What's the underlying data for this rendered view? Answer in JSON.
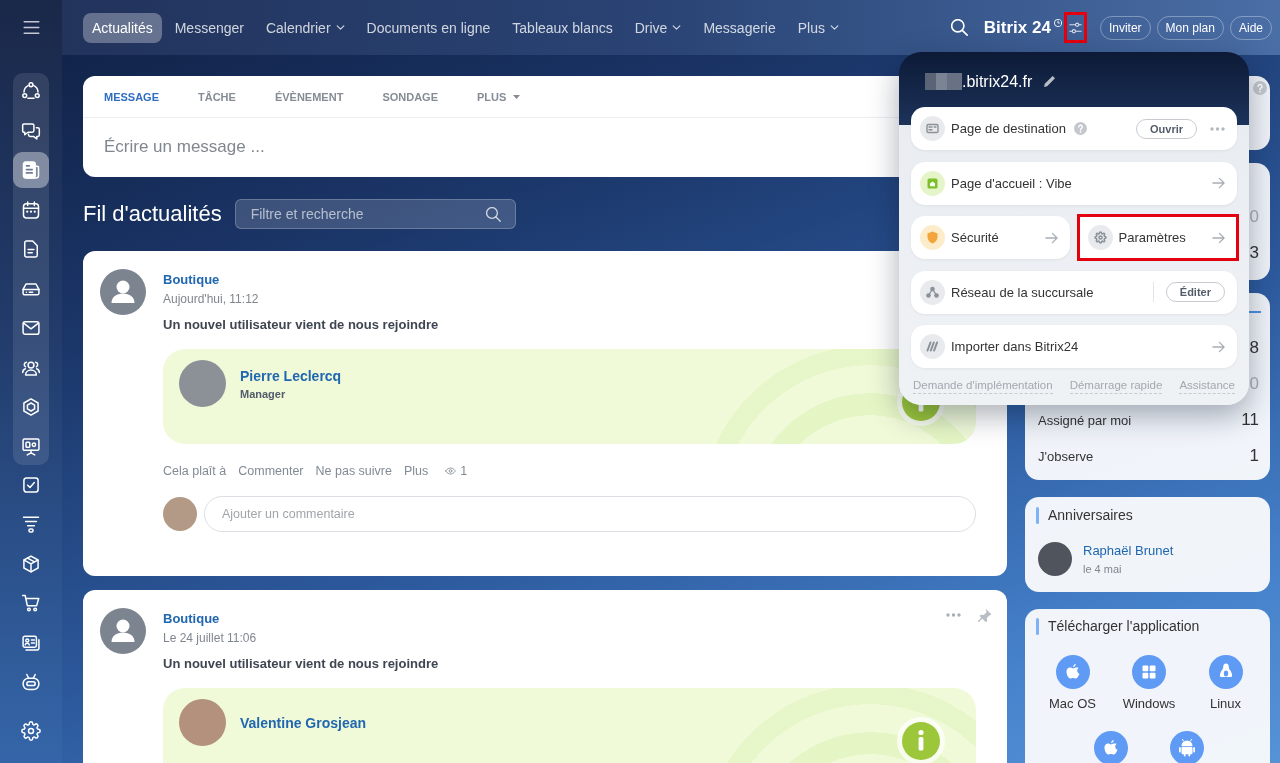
{
  "sidebar": {
    "pinned": [
      {
        "kind": "flows",
        "selected": false
      },
      {
        "kind": "chat",
        "selected": false
      },
      {
        "kind": "news",
        "selected": true
      },
      {
        "kind": "calendar",
        "selected": false
      },
      {
        "kind": "docs",
        "selected": false
      },
      {
        "kind": "drive",
        "selected": false
      },
      {
        "kind": "mail",
        "selected": false
      },
      {
        "kind": "groups",
        "selected": false
      },
      {
        "kind": "hexagon",
        "selected": false
      },
      {
        "kind": "board",
        "selected": false
      }
    ],
    "items": [
      {
        "kind": "tasks",
        "selected": false
      },
      {
        "kind": "funnel",
        "selected": false
      },
      {
        "kind": "box",
        "selected": false
      },
      {
        "kind": "cart",
        "selected": false
      },
      {
        "kind": "card",
        "selected": false
      },
      {
        "kind": "robot",
        "selected": false
      }
    ],
    "bottom": [
      {
        "kind": "settings",
        "selected": false
      }
    ]
  },
  "topbar": {
    "menu": [
      {
        "label": "Actualités",
        "selected": true,
        "dropdown": false
      },
      {
        "label": "Messenger",
        "selected": false,
        "dropdown": false
      },
      {
        "label": "Calendrier",
        "selected": false,
        "dropdown": true
      },
      {
        "label": "Documents en ligne",
        "selected": false,
        "dropdown": false
      },
      {
        "label": "Tableaux blancs",
        "selected": false,
        "dropdown": false
      },
      {
        "label": "Drive",
        "selected": false,
        "dropdown": true
      },
      {
        "label": "Messagerie",
        "selected": false,
        "dropdown": false
      },
      {
        "label": "Plus",
        "selected": false,
        "dropdown": true
      }
    ],
    "brand": "Bitrix 24",
    "settings": {
      "highlighted": true
    },
    "buttons": [
      "Inviter",
      "Mon plan",
      "Aide"
    ]
  },
  "composer": {
    "tabs": [
      {
        "label": "MESSAGE",
        "selected": true,
        "dropdown": false
      },
      {
        "label": "TÂCHE",
        "selected": false,
        "dropdown": false
      },
      {
        "label": "ÉVÈNEMENT",
        "selected": false,
        "dropdown": false
      },
      {
        "label": "SONDAGE",
        "selected": false,
        "dropdown": false
      },
      {
        "label": "PLUS",
        "selected": false,
        "dropdown": true
      }
    ],
    "placeholder": "Écrire un message ..."
  },
  "feed": {
    "title": "Fil d'actualités",
    "search": {
      "placeholder": "Filtre et recherche"
    },
    "posts": [
      {
        "author": "Boutique",
        "time": "Aujourd'hui, 11:12",
        "text": "Un nouvel utilisateur vient de nous rejoindre",
        "user": {
          "name": "Pierre Leclercq",
          "role": "Manager"
        },
        "actions": [
          "Cela plaît à",
          "Commenter",
          "Ne pas suivre",
          "Plus"
        ],
        "views": "1",
        "comment": {
          "placeholder": "Ajouter un commentaire"
        }
      },
      {
        "author": "Boutique",
        "time": "Le 24 juillet 11:06",
        "text": "Un nouvel utilisateur vient de nous rejoindre",
        "user": {
          "name": "Valentine Grosjean"
        },
        "controls": true
      }
    ]
  },
  "right_panel": {
    "cards": [
      {
        "kind": "help"
      },
      {
        "kind": "counters",
        "counters": [
          {
            "count": "0",
            "muted": true
          },
          {
            "count": "3",
            "muted": false
          }
        ]
      },
      {
        "kind": "tasks",
        "counters": [
          {
            "count": "8",
            "muted": false
          },
          {
            "count": "0",
            "muted": true
          },
          {
            "label": "Assigné par moi",
            "count": "11",
            "muted": false
          },
          {
            "label": "J'observe",
            "count": "1",
            "muted": false
          }
        ]
      },
      {
        "kind": "birthdays",
        "title": "Anniversaires",
        "people": [
          {
            "name": "Raphaël Brunet",
            "date": "le 4 mai"
          }
        ]
      },
      {
        "kind": "apps",
        "title": "Télécharger l'application",
        "apps": [
          {
            "kind": "apple",
            "label": "Mac OS"
          },
          {
            "kind": "windows",
            "label": "Windows"
          },
          {
            "kind": "linux",
            "label": "Linux"
          },
          {
            "kind": "apple"
          },
          {
            "kind": "android"
          }
        ]
      }
    ]
  },
  "popup": {
    "domain": ".bitrix24.fr",
    "rows": [
      {
        "items": [
          {
            "kind": "landing",
            "label": "Page de destination",
            "help": true,
            "button": "Ouvrir",
            "more": true,
            "highlighted": false
          }
        ]
      },
      {
        "items": [
          {
            "kind": "home",
            "label": "Page d'accueil : Vibe",
            "arrow": true,
            "highlighted": false
          }
        ]
      },
      {
        "items": [
          {
            "kind": "security",
            "label": "Sécurité",
            "arrow": true,
            "highlighted": false
          },
          {
            "kind": "settings",
            "label": "Paramètres",
            "arrow": true,
            "highlighted": true
          }
        ]
      },
      {
        "items": [
          {
            "kind": "network",
            "label": "Réseau de la succursale",
            "divider": true,
            "button": "Éditer",
            "highlighted": false
          }
        ]
      },
      {
        "items": [
          {
            "kind": "import",
            "label": "Importer dans Bitrix24",
            "arrow": true,
            "highlighted": false
          }
        ]
      }
    ],
    "links": [
      "Demande d'implémentation",
      "Démarrage rapide",
      "Assistance"
    ]
  }
}
